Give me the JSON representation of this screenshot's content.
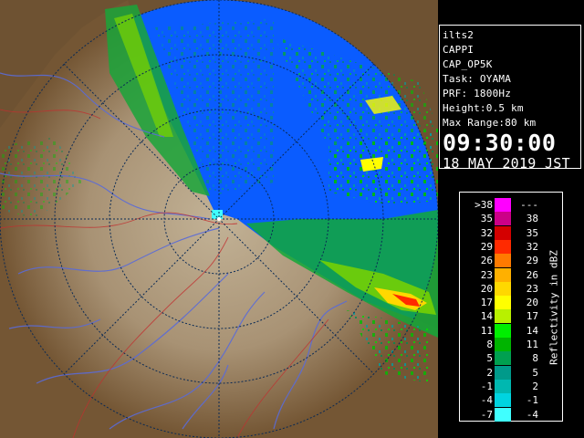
{
  "radar_view": {
    "icon": "radar-ppi-map"
  },
  "info": {
    "site": "ilts2",
    "product": "CAPPI",
    "variant": "CAP_OP5K",
    "task": "Task: OYAMA",
    "prf": "PRF: 1800Hz",
    "height": "Height:0.5 km",
    "max_range": "Max Range:80 km",
    "time": "09:30:00",
    "date": "18 MAY 2019 JST"
  },
  "legend": {
    "title": "Reflectivity in dBZ",
    "rows": [
      {
        "lo": ">38",
        "hi": "---",
        "color": "#ff00ff"
      },
      {
        "lo": "35",
        "hi": "38",
        "color": "#cc0088"
      },
      {
        "lo": "32",
        "hi": "35",
        "color": "#d40000"
      },
      {
        "lo": "29",
        "hi": "32",
        "color": "#ff2a00"
      },
      {
        "lo": "26",
        "hi": "29",
        "color": "#ff7a00"
      },
      {
        "lo": "23",
        "hi": "26",
        "color": "#ffb000"
      },
      {
        "lo": "20",
        "hi": "23",
        "color": "#ffd800"
      },
      {
        "lo": "17",
        "hi": "20",
        "color": "#ffff00"
      },
      {
        "lo": "14",
        "hi": "17",
        "color": "#b8f000"
      },
      {
        "lo": "11",
        "hi": "14",
        "color": "#00ee00"
      },
      {
        "lo": "8",
        "hi": "11",
        "color": "#00b400"
      },
      {
        "lo": "5",
        "hi": "8",
        "color": "#00a050"
      },
      {
        "lo": "2",
        "hi": "5",
        "color": "#009a8a"
      },
      {
        "lo": "-1",
        "hi": "2",
        "color": "#00b8b0"
      },
      {
        "lo": "-4",
        "hi": "-1",
        "color": "#00d4e0"
      },
      {
        "lo": "-7",
        "hi": "-4",
        "color": "#40ffff"
      }
    ]
  },
  "colors": {
    "sea": "#0a5cff",
    "land_dark": "#6e5232",
    "land_light": "#b6a488",
    "range_ring": "#0a2a55",
    "river": "#5a6bd8",
    "border": "#c03030"
  }
}
